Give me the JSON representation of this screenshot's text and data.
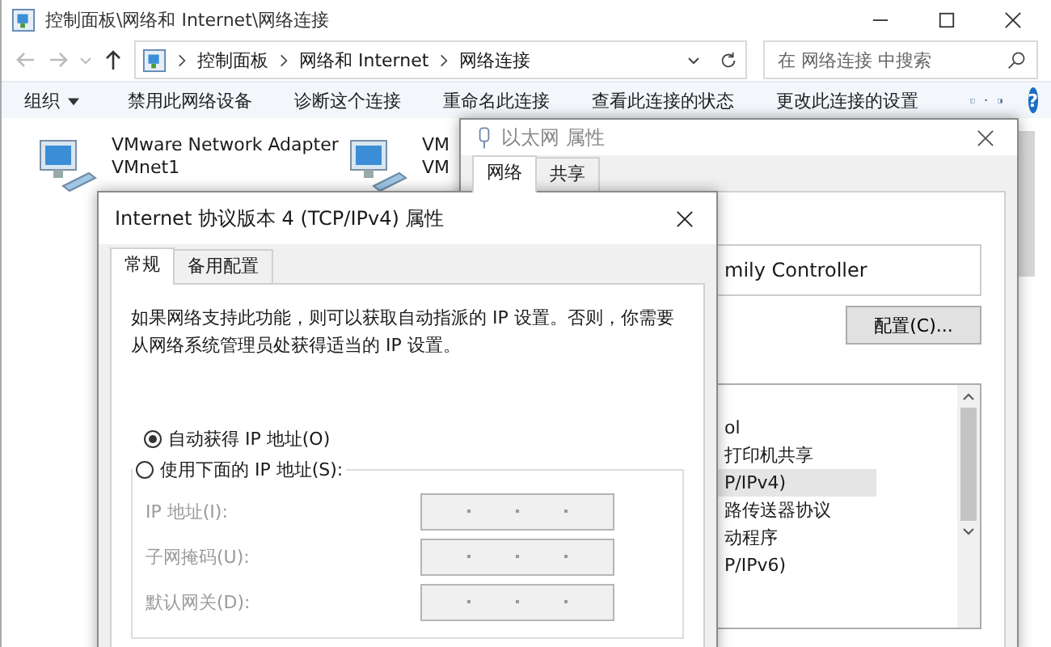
{
  "explorer": {
    "title": "控制面板\\网络和 Internet\\网络连接",
    "breadcrumbs": [
      "控制面板",
      "网络和 Internet",
      "网络连接"
    ],
    "search": {
      "placeholder": "在 网络连接 中搜索"
    },
    "toolbar": [
      {
        "label": "组织",
        "kind": "menu"
      },
      {
        "label": "禁用此网络设备",
        "kind": "command"
      },
      {
        "label": "诊断这个连接",
        "kind": "command"
      },
      {
        "label": "重命名此连接",
        "kind": "command"
      },
      {
        "label": "查看此连接的状态",
        "kind": "command"
      },
      {
        "label": "更改此连接的设置",
        "kind": "command"
      }
    ],
    "help": "?",
    "adapters": [
      {
        "name": "VMware Network Adapter",
        "detail": "VMnet1"
      },
      {
        "name": "VM",
        "detail": "VM"
      }
    ]
  },
  "ethernet_dialog": {
    "title": "以太网 属性",
    "tabs": [
      {
        "label": "网络",
        "selected": true
      },
      {
        "label": "共享",
        "selected": false
      }
    ],
    "adapter_field": "mily Controller",
    "configure_button": "配置(C)...",
    "items": [
      {
        "label": "ol",
        "selected": false
      },
      {
        "label": "打印机共享",
        "selected": false
      },
      {
        "label": "P/IPv4)",
        "selected": true
      },
      {
        "label": "路传送器协议",
        "selected": false
      },
      {
        "label": "动程序",
        "selected": false
      },
      {
        "label": "P/IPv6)",
        "selected": false
      }
    ]
  },
  "ipv4_dialog": {
    "title": "Internet 协议版本 4 (TCP/IPv4) 属性",
    "tabs": [
      {
        "label": "常规",
        "selected": true
      },
      {
        "label": "备用配置",
        "selected": false
      }
    ],
    "description": "如果网络支持此功能，则可以获取自动指派的 IP 设置。否则，你需要从网络系统管理员处获得适当的 IP 设置。",
    "radios": [
      {
        "label": "自动获得 IP 地址(O)",
        "selected": true
      },
      {
        "label": "使用下面的 IP 地址(S):",
        "selected": false
      }
    ],
    "fields_disabled": true,
    "fields": [
      {
        "label": "IP 地址(I):"
      },
      {
        "label": "子网掩码(U):"
      },
      {
        "label": "默认网关(D):"
      }
    ]
  }
}
